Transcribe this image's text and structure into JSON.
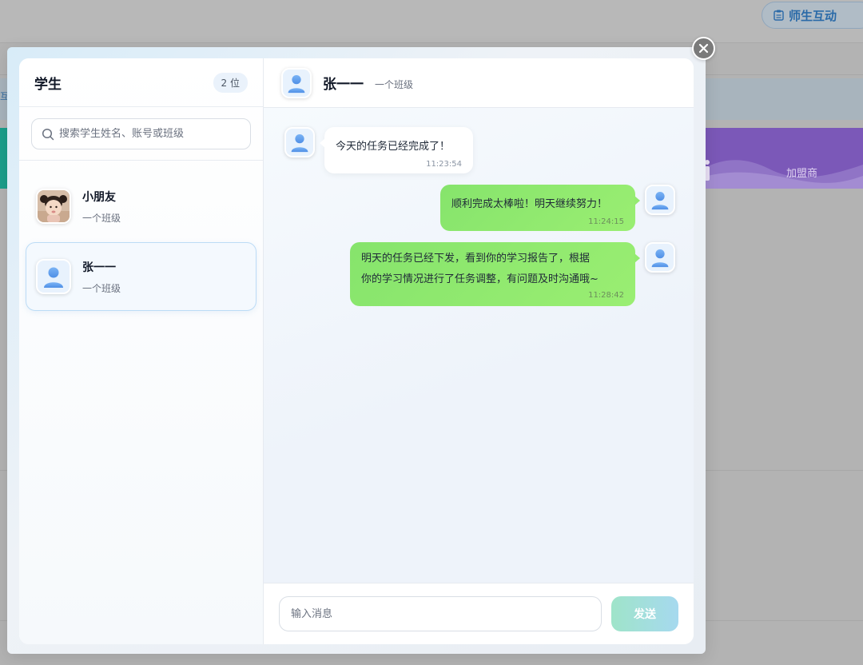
{
  "background": {
    "interact_button_label": "师生互动",
    "bluebar_edge_text": "互",
    "banner_label": "加盟商"
  },
  "sidebar": {
    "title": "学生",
    "count_badge": "2 位",
    "search": {
      "placeholder": "搜索学生姓名、账号或班级",
      "value": ""
    },
    "students": [
      {
        "name": "小朋友",
        "class": "一个班级",
        "avatar": "child-photo",
        "active": false
      },
      {
        "name": "张一一",
        "class": "一个班级",
        "avatar": "user-icon",
        "active": true
      }
    ]
  },
  "chat": {
    "header": {
      "name": "张一一",
      "class": "一个班级"
    },
    "messages": [
      {
        "direction": "in",
        "text": "今天的任务已经完成了！",
        "time": "11:23:54"
      },
      {
        "direction": "out",
        "text": "顺利完成太棒啦！明天继续努力！",
        "time": "11:24:15"
      },
      {
        "direction": "out",
        "lines": [
          "明天的任务已经下发，看到你的学习报告了，根据",
          "你的学习情况进行了任务调整，有问题及时沟通哦~"
        ],
        "time": "11:28:42"
      }
    ],
    "input": {
      "placeholder": "输入消息",
      "value": ""
    },
    "send_label": "发送"
  },
  "colors": {
    "accent_green": "#8ee86e",
    "send_gradient_start": "#9fe4c9",
    "send_gradient_end": "#a6d9ef",
    "active_border": "#bcdcf6"
  }
}
